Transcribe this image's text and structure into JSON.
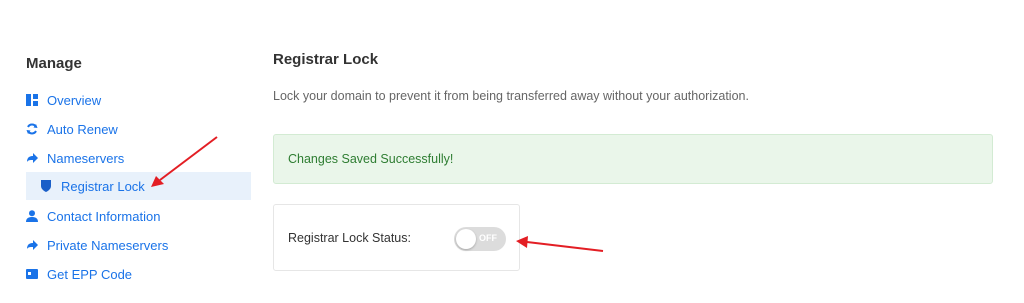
{
  "sidebar": {
    "title": "Manage",
    "items": [
      {
        "label": "Overview",
        "icon": "dashboard-icon"
      },
      {
        "label": "Auto Renew",
        "icon": "sync-icon"
      },
      {
        "label": "Nameservers",
        "icon": "share-arrow-icon"
      },
      {
        "label": "Registrar Lock",
        "icon": "shield-icon",
        "active": true
      },
      {
        "label": "Contact Information",
        "icon": "user-icon"
      },
      {
        "label": "Private Nameservers",
        "icon": "share-arrow-icon"
      },
      {
        "label": "Get EPP Code",
        "icon": "id-card-icon"
      }
    ]
  },
  "main": {
    "title": "Registrar Lock",
    "description": "Lock your domain to prevent it from being transferred away without your authorization.",
    "alert": "Changes Saved Successfully!",
    "status_label": "Registrar Lock Status:",
    "toggle_text": "OFF",
    "toggle_on": false
  },
  "colors": {
    "link": "#1a73e8",
    "active_bg": "#e8f1fb",
    "alert_bg": "#eaf6ea",
    "alert_text": "#2e7d32",
    "annotation_arrow": "#e31e24"
  }
}
